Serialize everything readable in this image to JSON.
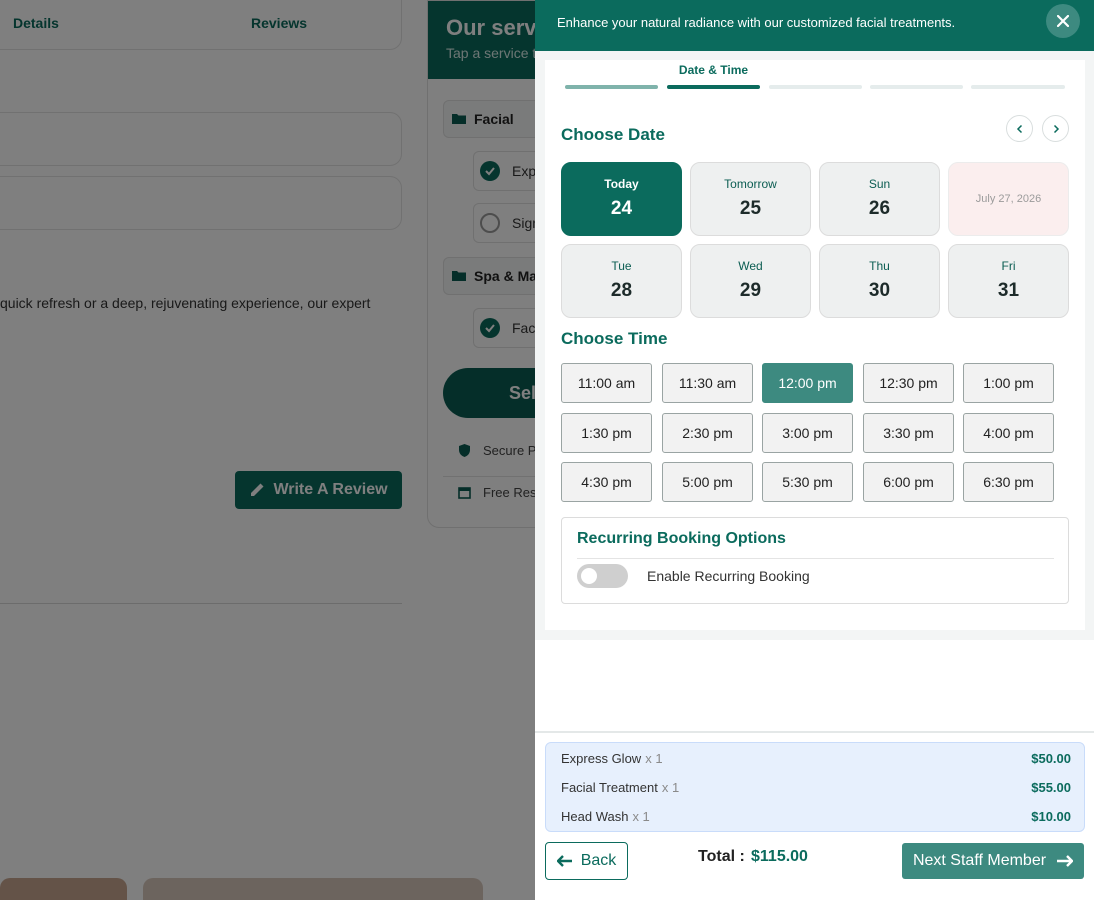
{
  "background": {
    "tabs": [
      "Details",
      "Reviews"
    ],
    "description": "quick refresh or a deep, rejuvenating experience, our expert",
    "review_button": "Write A Review",
    "services_card": {
      "title": "Our serv",
      "subtitle": "Tap a service t",
      "categories": [
        {
          "name": "Facial",
          "items": [
            {
              "label": "Exp",
              "checked": true
            },
            {
              "label": "Sign",
              "checked": false
            }
          ]
        },
        {
          "name": "Spa & Mas",
          "items": [
            {
              "label": "Faci",
              "checked": true
            }
          ]
        }
      ],
      "select_button": "Sele",
      "features": [
        "Secure P",
        "Free Rese"
      ]
    }
  },
  "drawer": {
    "header_text": "Enhance your natural radiance with our customized facial treatments.",
    "steps": {
      "active_label": "Date & Time",
      "active_index": 1,
      "count": 5
    },
    "choose_date_title": "Choose Date",
    "dates": [
      {
        "name": "Today",
        "num": "24",
        "state": "selected"
      },
      {
        "name": "Tomorrow",
        "num": "25",
        "state": "normal"
      },
      {
        "name": "Sun",
        "num": "26",
        "state": "normal"
      },
      {
        "full": "July 27, 2026",
        "state": "unavailable"
      },
      {
        "name": "Tue",
        "num": "28",
        "state": "normal"
      },
      {
        "name": "Wed",
        "num": "29",
        "state": "normal"
      },
      {
        "name": "Thu",
        "num": "30",
        "state": "normal"
      },
      {
        "name": "Fri",
        "num": "31",
        "state": "normal"
      }
    ],
    "choose_time_title": "Choose Time",
    "times": [
      "11:00 am",
      "11:30 am",
      "12:00 pm",
      "12:30 pm",
      "1:00 pm",
      "1:30 pm",
      "2:30 pm",
      "3:00 pm",
      "3:30 pm",
      "4:00 pm",
      "4:30 pm",
      "5:00 pm",
      "5:30 pm",
      "6:00 pm",
      "6:30 pm"
    ],
    "selected_time": "12:00 pm",
    "recurring": {
      "title": "Recurring Booking Options",
      "toggle_label": "Enable Recurring Booking",
      "enabled": false
    },
    "summary": [
      {
        "name": "Express Glow",
        "qty": "x 1",
        "price": "$50.00"
      },
      {
        "name": "Facial Treatment",
        "qty": "x 1",
        "price": "$55.00"
      },
      {
        "name": "Head Wash",
        "qty": "x 1",
        "price": "$10.00"
      }
    ],
    "back_label": "Back",
    "total_label": "Total :",
    "total_value": "$115.00",
    "next_label": "Next Staff Member"
  },
  "colors": {
    "brand": "#0b6b5d",
    "accent": "#3d8a80",
    "summary_bg": "#e7f0fd",
    "unavailable_bg": "#fbeeee"
  }
}
